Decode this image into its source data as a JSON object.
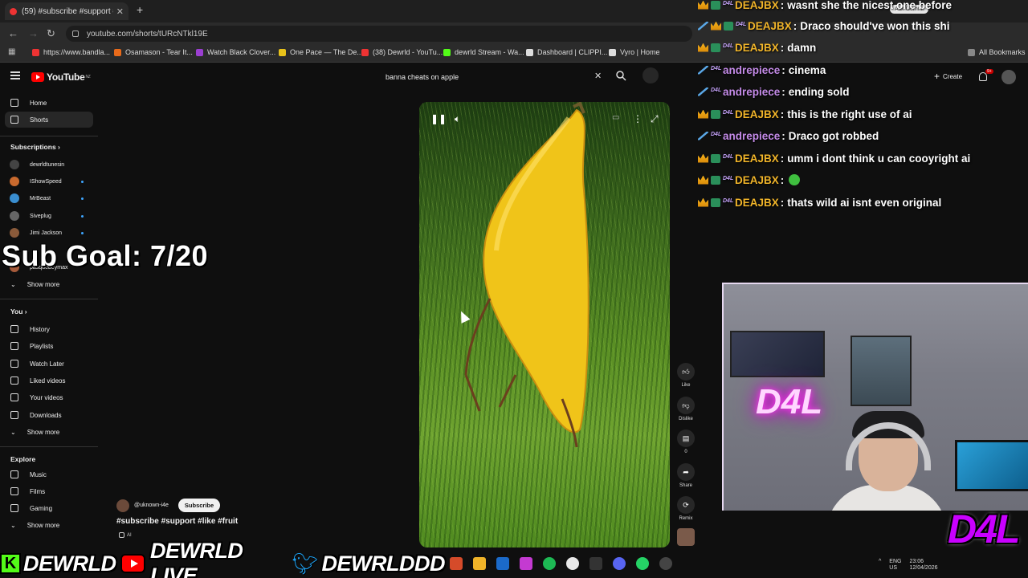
{
  "browser": {
    "tab_title": "(59) #subscribe #support #...",
    "url": "youtube.com/shorts/tURcNTkl19E",
    "bookmarks": [
      {
        "label": "https://www.bandla...",
        "color": "#e33"
      },
      {
        "label": "Osamason - Tear It...",
        "color": "#e86a1a"
      },
      {
        "label": "Watch Black Clover...",
        "color": "#9b3fd1"
      },
      {
        "label": "One Pace — The De...",
        "color": "#e8c21a"
      },
      {
        "label": "(38) Dewrld - YouTu...",
        "color": "#e33"
      },
      {
        "label": "dewrld Stream - Wa...",
        "color": "#53fc18"
      },
      {
        "label": "Dashboard | CLIPPI...",
        "color": "#ddd"
      },
      {
        "label": "Vyro | Home",
        "color": "#ddd"
      }
    ],
    "all_bookmarks": "All Bookmarks",
    "ask_gemini": "Ask Gemini"
  },
  "youtube": {
    "logo": "YouTube",
    "region": "NZ",
    "search_value": "banna cheats on apple",
    "create_label": "Create",
    "notification_count": "9+"
  },
  "sidebar": {
    "home": "Home",
    "shorts": "Shorts",
    "subscriptions_label": "Subscriptions",
    "subscriptions": [
      {
        "name": "dewrldtunesin",
        "color": "#444"
      },
      {
        "name": "IShowSpeed",
        "color": "#c96a2e"
      },
      {
        "name": "MrBeast",
        "color": "#3a8ed0"
      },
      {
        "name": "Siveplug",
        "color": "#666"
      },
      {
        "name": "Jimi Jackson",
        "color": "#8a5a3a"
      },
      {
        "name": "",
        "color": "#555"
      },
      {
        "name": "pasquebeymax",
        "color": "#a65a3a"
      }
    ],
    "show_more": "Show more",
    "you_label": "You",
    "you_items": [
      "History",
      "Playlists",
      "Watch Later",
      "Liked videos",
      "Your videos",
      "Downloads"
    ],
    "show_more_2": "Show more",
    "explore_label": "Explore",
    "explore_items": [
      "Music",
      "Films",
      "Gaming"
    ],
    "show_more_3": "Show more"
  },
  "overlay": {
    "sub_goal": "Sub Goal: 7/20"
  },
  "short": {
    "channel": "@uknown-i4e",
    "subscribe": "Subscribe",
    "description": "#subscribe #support #like #fruit",
    "ai_label": "AI",
    "like_label": "Like",
    "dislike_label": "Dislike",
    "comments_count": "0",
    "share_label": "Share",
    "remix_label": "Remix"
  },
  "chat": [
    {
      "user": "DEAJBX",
      "style": "deajbx",
      "message": "wasnt she the nicest one before",
      "emote": false
    },
    {
      "user": "DEAJBX",
      "style": "deajbx",
      "message": "Draco should've won this shi",
      "emote": false
    },
    {
      "user": "DEAJBX",
      "style": "deajbx",
      "message": "damn",
      "emote": false
    },
    {
      "user": "andrepiece",
      "style": "andre",
      "message": "cinema",
      "emote": false
    },
    {
      "user": "andrepiece",
      "style": "andre",
      "message": "ending sold",
      "emote": false
    },
    {
      "user": "DEAJBX",
      "style": "deajbx",
      "message": "this is the right use of ai",
      "emote": false
    },
    {
      "user": "andrepiece",
      "style": "andre",
      "message": "Draco got robbed",
      "emote": false
    },
    {
      "user": "DEAJBX",
      "style": "deajbx",
      "message": "umm i dont think u can cooyright ai",
      "emote": false
    },
    {
      "user": "DEAJBX",
      "style": "deajbx",
      "message": "",
      "emote": true
    },
    {
      "user": "DEAJBX",
      "style": "deajbx",
      "message": "thats wild ai isnt even original",
      "emote": false
    }
  ],
  "webcam": {
    "neon_sign": "D4L",
    "brand_logo": "D4L"
  },
  "banner": {
    "kick": "DEWRLD",
    "youtube": "DEWRLD LIVE",
    "twitter": "DEWRLDDD"
  },
  "system_tray": {
    "lang": "ENG",
    "region": "US",
    "time": "23:06",
    "date": "12/04/2026"
  }
}
